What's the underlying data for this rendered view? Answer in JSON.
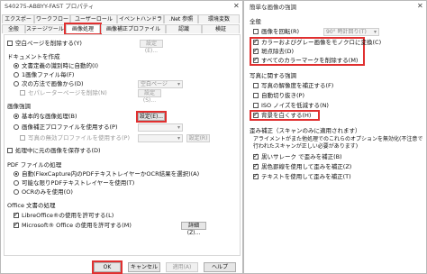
{
  "left": {
    "title": "S40275-ABBYY-FAST プロパティ",
    "tabs_row1": [
      "エクスポート",
      "ワークフロー",
      "ユーザーロール",
      "イベントハンドラ",
      ".Net 参照",
      "環境変数"
    ],
    "tabs_row2": [
      "全般",
      "ステージツール",
      "画像処理",
      "画像補正プロファイル",
      "認識",
      "検証"
    ],
    "blank_pages": "空白ページを削除する(Y)",
    "settings_btn_e": "設定(E)...",
    "doc_split": "ドキュメントを作成",
    "radio_doc1": "文書定義の識別時に自動的(I)",
    "radio_doc2": "1画像ファイル毎(F)",
    "radio_doc3": "次の方法で画像から(D)",
    "combo_doc3": "空白ページ",
    "separator_page": "セパレーターページを削除(N)",
    "settings_btn_s": "設定(S)...",
    "image_proc": "画像強調",
    "radio_basic": "基本的な画像処理(B)",
    "settings_btn_basic": "設定(E)...",
    "radio_profile": "画像補正プロファイルを使用する(P)",
    "write_profile": "写真の無効プロファイルを使用する(P)",
    "profile_btn": "設定(R)",
    "auto_rotate": "処理中に元の画像を保存する(D)",
    "pdf_section": "PDF ファイルの処理",
    "pdf_auto": "自動(FlexCapture内のPDFテキストレイヤーかOCR結果を選択)(A)",
    "pdf_text": "可能な限りPDFテキストレイヤーを使用(T)",
    "pdf_ocr": "OCRのみを使用(O)",
    "office_section": "Office 文書の処理",
    "libre": "LibreOffice®の使用を許可する(L)",
    "msoffice": "Microsoft® Office の使用を許可する(M)",
    "details_btn": "詳細(Z)...",
    "ok": "OK",
    "cancel": "キャンセル",
    "apply": "適用(A)",
    "help": "ヘルプ"
  },
  "right": {
    "title": "簡単な画像の強調",
    "general": "全般",
    "rotate": "画像を回転(R)",
    "rotate_combo": "90° 時計回り(T)",
    "grayscale": "カラーおよびグレー画像をモノクロに変換(C)",
    "despeckle": "斑点除去(D)",
    "remove_color": "すべてのカラーマークを削除する(M)",
    "photo_section": "写真に関する強調",
    "correct_res": "写真の解像度を補正する(F)",
    "auto_crop": "自動切り抜き(P)",
    "iso_noise": "ISO ノイズを低減する(N)",
    "whiten": "背景を白くする(H)",
    "skew_section": "歪み補正（スキャンのみに適用されます）",
    "skew_desc1": "アライメントがまた他処理でのこれらのオプションを無効化(不注意で",
    "skew_desc2": "行われたスキャンが正しい必要があります)",
    "black_bar": "黒いサレーク で歪みを補正(B)",
    "skew_lines": "黒色罫線を使用して歪みを補正(Z)",
    "skew_text": "テキストを使用して歪みを補正(T)"
  }
}
